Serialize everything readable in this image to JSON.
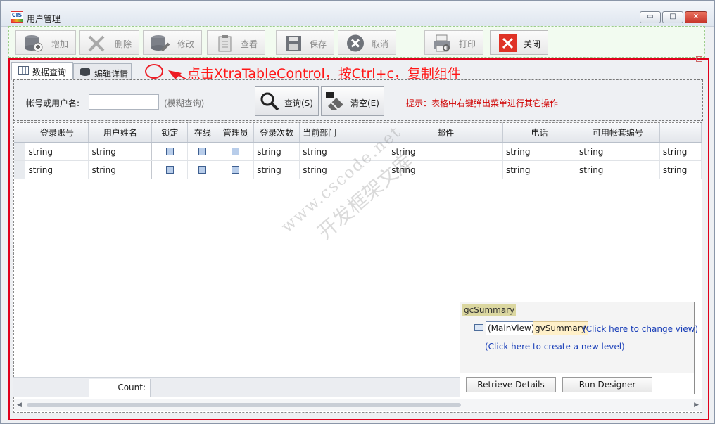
{
  "window": {
    "title": "用户管理",
    "minimize": "▭",
    "maximize": "□",
    "close": "×"
  },
  "toolbar": {
    "buttons": [
      {
        "label": "增加",
        "icon": "database-add-icon"
      },
      {
        "label": "删除",
        "icon": "x-delete-icon"
      },
      {
        "label": "修改",
        "icon": "database-edit-icon"
      },
      {
        "label": "查看",
        "icon": "clipboard-view-icon"
      },
      {
        "label": "保存",
        "icon": "floppy-save-icon"
      },
      {
        "label": "取消",
        "icon": "cancel-circle-icon"
      },
      {
        "label": "打印",
        "icon": "printer-icon"
      },
      {
        "label": "关闭",
        "icon": "close-red-icon"
      }
    ]
  },
  "tabs": [
    {
      "label": "数据查询",
      "icon": "table-icon",
      "active": true
    },
    {
      "label": "编辑详情",
      "icon": "database-icon",
      "active": false
    }
  ],
  "annotation": {
    "text": "点击XtraTableControl，按Ctrl+c，复制组件"
  },
  "search": {
    "label": "帐号或用户名:",
    "value": "",
    "fuzzy_hint": "(模糊查询)",
    "query_button": "查询(S)",
    "clear_button": "清空(E)",
    "tip": "提示：表格中右键弹出菜单进行其它操作"
  },
  "grid": {
    "columns": [
      "登录账号",
      "用户姓名",
      "锁定",
      "在线",
      "管理员",
      "登录次数",
      "当前部门",
      "邮件",
      "电话",
      "可用帐套编号",
      ""
    ],
    "rows": [
      [
        "string",
        "string",
        true,
        true,
        true,
        "string",
        "string",
        "string",
        "string",
        "string",
        "string"
      ],
      [
        "string",
        "string",
        true,
        true,
        true,
        "string",
        "string",
        "string",
        "string",
        "string",
        "string"
      ]
    ],
    "count_label": "Count:"
  },
  "designer": {
    "title": "gcSummary",
    "main_view": "(MainView)",
    "view_name": "gvSummary",
    "change_view_link": "(Click here to change view)",
    "new_level_link": "(Click here to create a new level)",
    "retrieve_button": "Retrieve Details",
    "run_button": "Run Designer"
  },
  "watermark": {
    "line1": "www.cscode.net",
    "line2": "开发框架文库"
  }
}
